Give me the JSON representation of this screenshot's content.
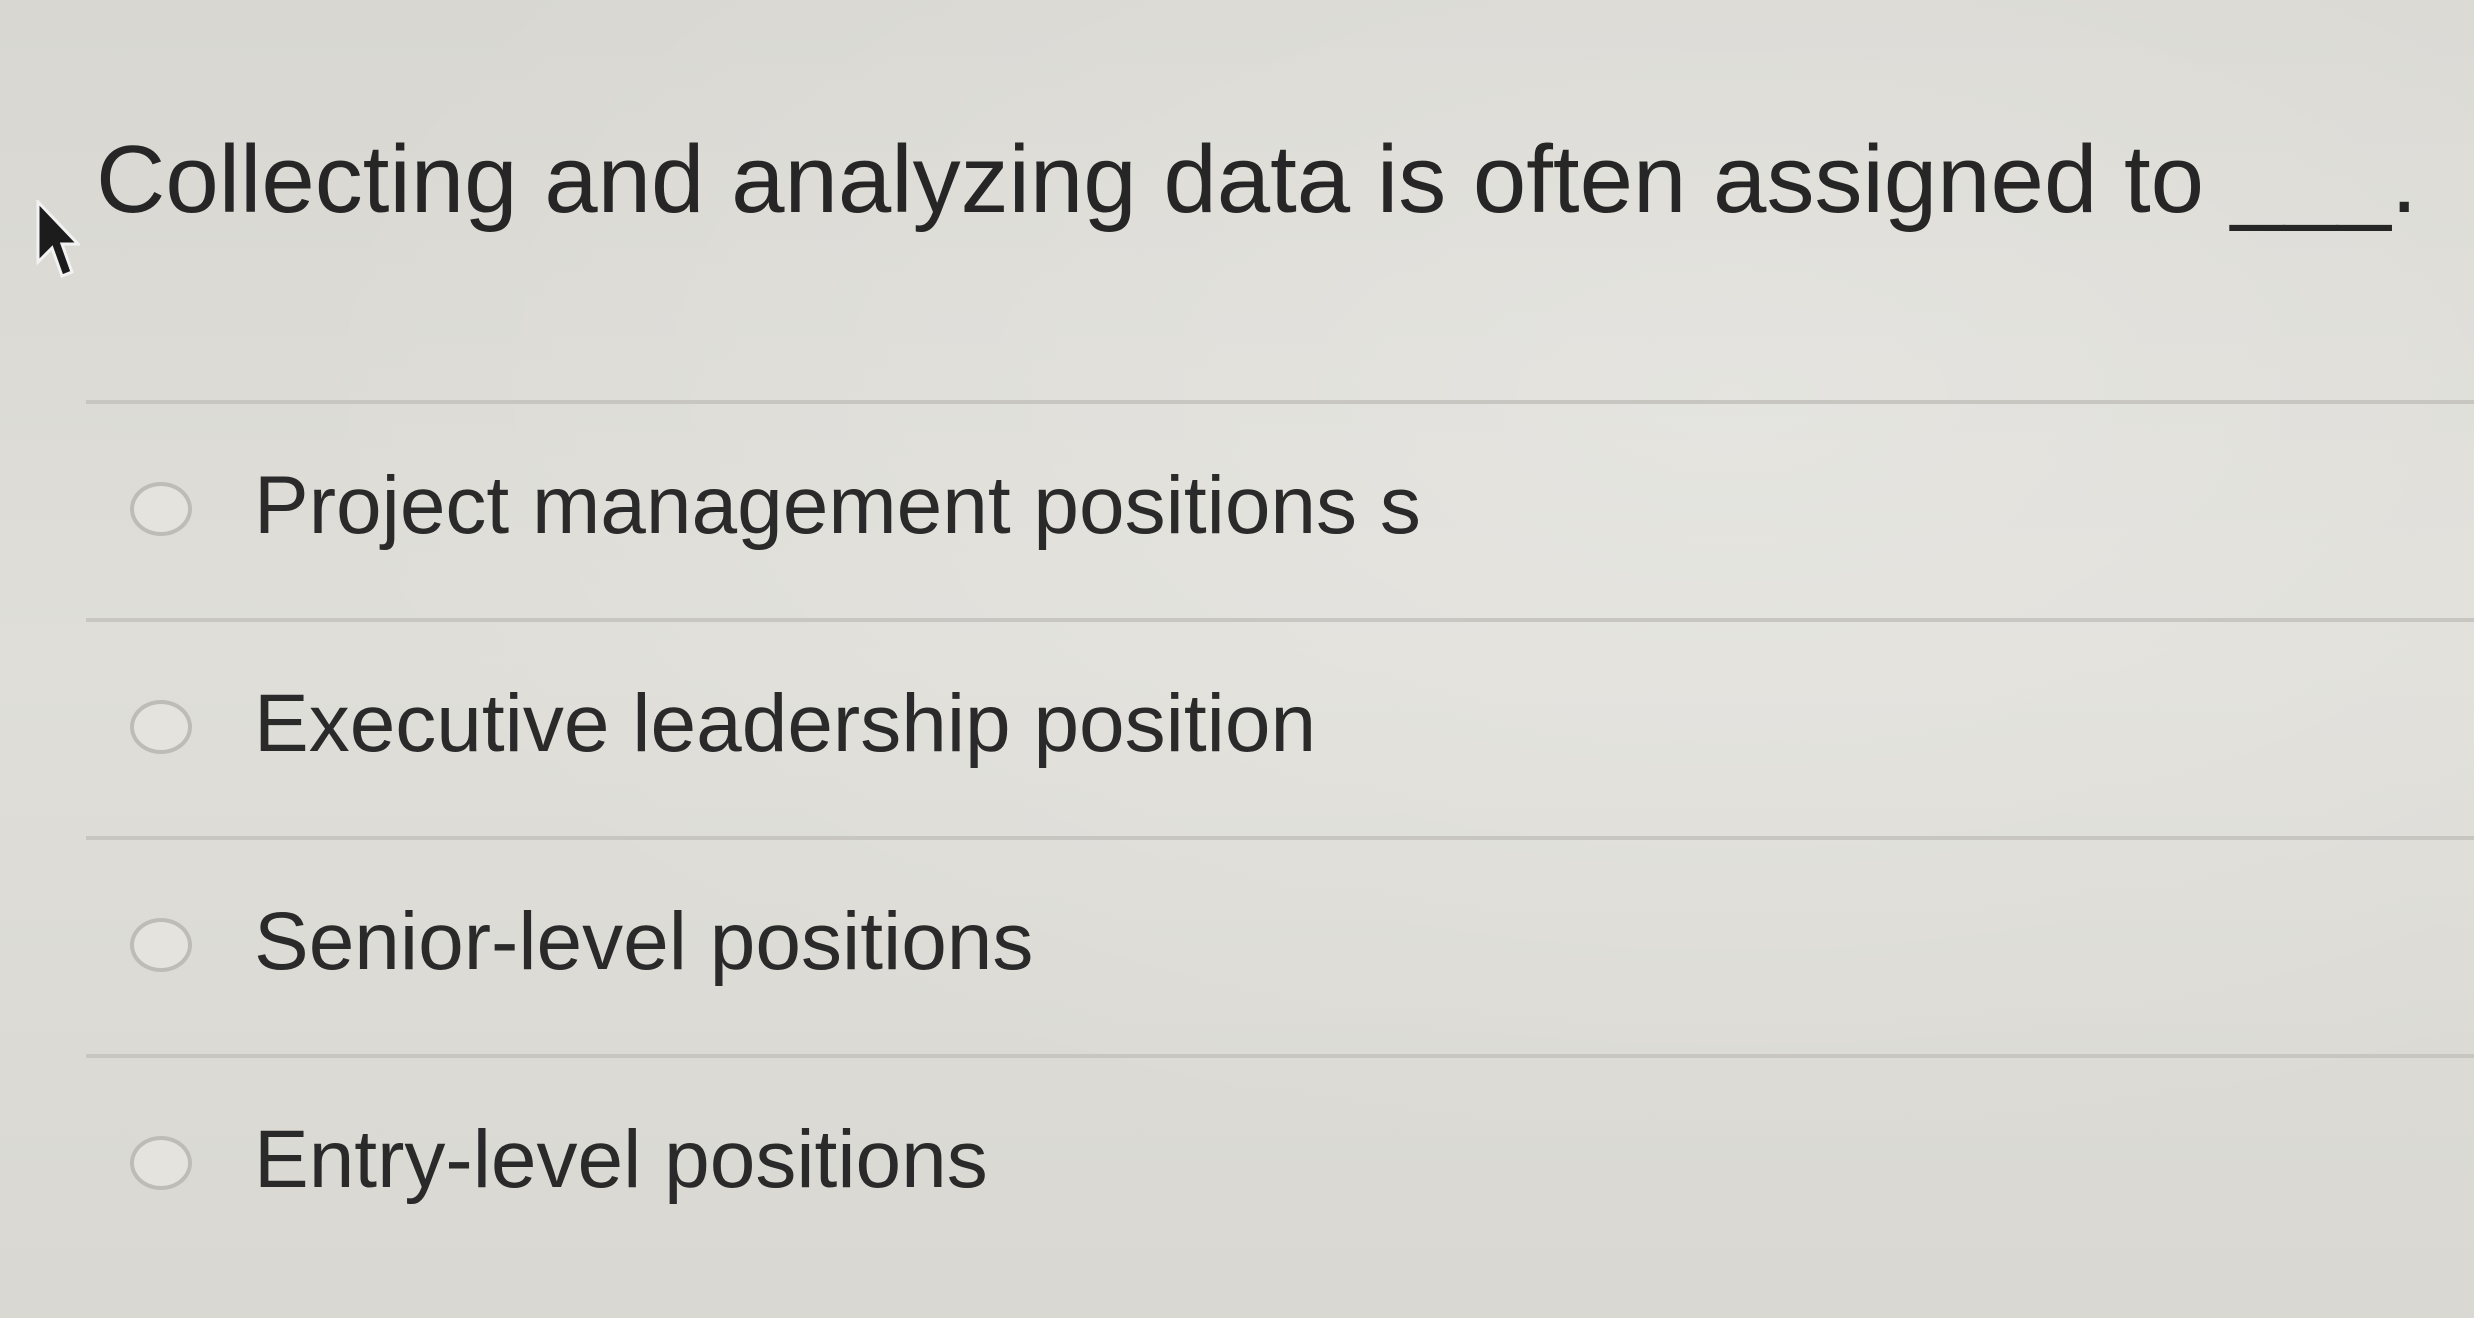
{
  "question": {
    "text": "Collecting and analyzing data is often assigned to ___."
  },
  "options": [
    {
      "label": "Project management positions s"
    },
    {
      "label": "Executive leadership position"
    },
    {
      "label": "Senior-level positions"
    },
    {
      "label": "Entry-level positions"
    }
  ]
}
